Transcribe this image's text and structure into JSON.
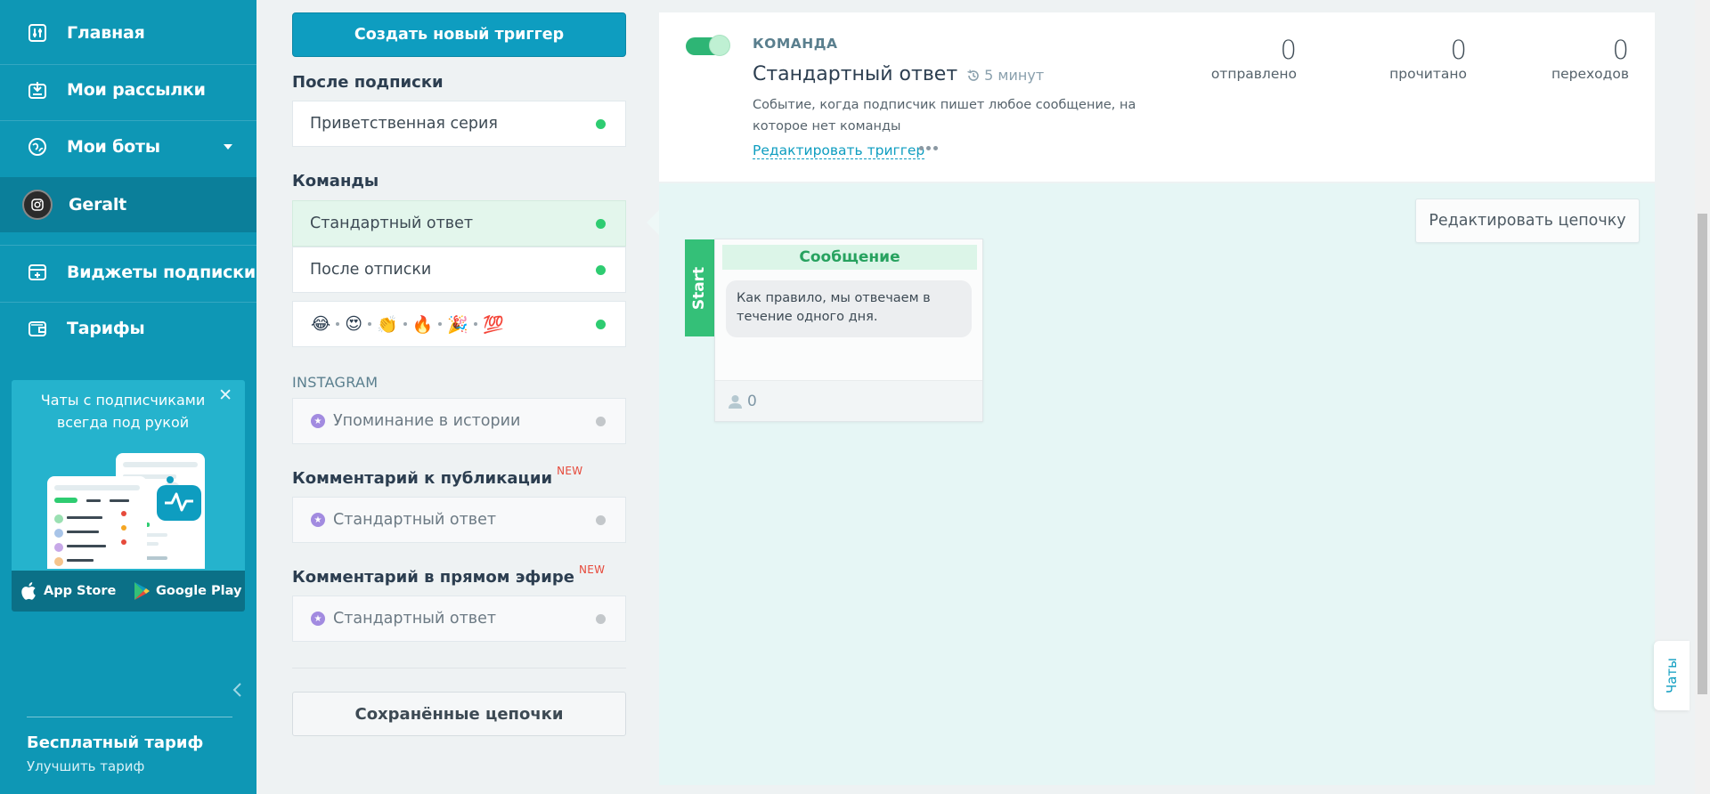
{
  "sidebar": {
    "nav": [
      {
        "label": "Главная",
        "icon": "dashboard-icon"
      },
      {
        "label": "Мои рассылки",
        "icon": "campaigns-icon"
      },
      {
        "label": "Мои боты",
        "icon": "bots-icon"
      },
      {
        "label": "Geralt",
        "icon": "instagram-avatar"
      },
      {
        "label": "Виджеты подписки",
        "icon": "widgets-icon"
      },
      {
        "label": "Тарифы",
        "icon": "wallet-icon"
      }
    ],
    "promo": {
      "text": "Чаты с подписчиками всегда под рукой",
      "close": "✕",
      "app_store": "App Store",
      "google_play": "Google Play"
    },
    "plan": {
      "name": "Бесплатный тариф",
      "upgrade": "Улучшить тариф"
    }
  },
  "triggers": {
    "create_button": "Создать новый триггер",
    "sections": {
      "after_subscribe": "После подписки",
      "commands": "Команды",
      "instagram": "INSTAGRAM",
      "post_comment": "Комментарий к публикации",
      "live_comment": "Комментарий в прямом эфире",
      "new_badge": "NEW"
    },
    "cards": {
      "welcome": "Приветственная серия",
      "standard": "Стандартный ответ",
      "unsubscribe": "После отписки",
      "emoji": [
        "😂",
        "😍",
        "👏",
        "🔥",
        "🎉",
        "💯"
      ],
      "story_mention": "Упоминание в истории",
      "post_standard": "Стандартный ответ",
      "live_standard": "Стандартный ответ"
    },
    "saved_button": "Сохранённые цепочки"
  },
  "trigger": {
    "type": "КОМАНДА",
    "name": "Стандартный ответ",
    "delay": "5 минут",
    "description": "Событие, когда подписчик пишет любое сообщение, на которое нет команды",
    "edit_link": "Редактировать триггер",
    "enabled": true,
    "stats": [
      {
        "value": "0",
        "label": "отправлено"
      },
      {
        "value": "0",
        "label": "прочитано"
      },
      {
        "value": "0",
        "label": "переходов"
      }
    ]
  },
  "chain": {
    "edit_button": "Редактировать цепочку",
    "start_label": "Start",
    "message": {
      "title": "Сообщение",
      "text": "Как правило, мы отвечаем в течение одного дня.",
      "subscribers": "0"
    }
  },
  "chats_tab": "Чаты",
  "colors": {
    "sidebar": "#0e97b5",
    "accent": "#0e9dc0",
    "green": "#2ecc71",
    "new_badge": "#e64a3b"
  }
}
